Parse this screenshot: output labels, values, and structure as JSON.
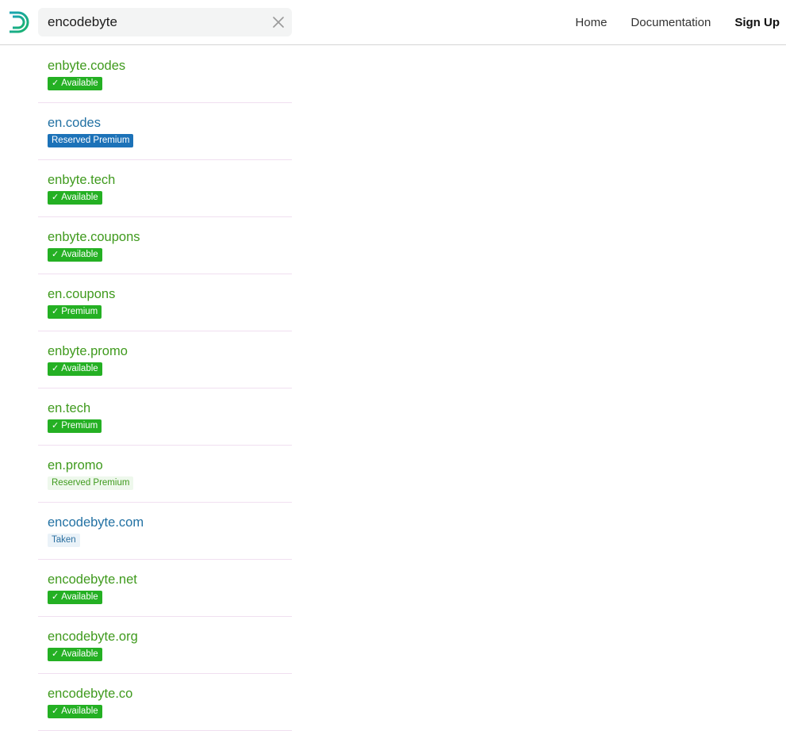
{
  "search": {
    "value": "encodebyte",
    "clear_icon": "close-icon"
  },
  "logo_icon": "logo-d-icon",
  "nav": {
    "home": "Home",
    "documentation": "Documentation",
    "signup": "Sign Up"
  },
  "colors": {
    "available_badge": "#24b023",
    "available_text": "#3f9a1d",
    "reserved_badge": "#1c72b8",
    "taken_text": "#2271a3"
  },
  "results": [
    {
      "domain": "enbyte.codes",
      "status": "available",
      "badge": "Available",
      "check": true
    },
    {
      "domain": "en.codes",
      "status": "reserved",
      "badge": "Reserved Premium",
      "check": false
    },
    {
      "domain": "enbyte.tech",
      "status": "available",
      "badge": "Available",
      "check": true
    },
    {
      "domain": "enbyte.coupons",
      "status": "available",
      "badge": "Available",
      "check": true
    },
    {
      "domain": "en.coupons",
      "status": "premium",
      "badge": "Premium",
      "check": true
    },
    {
      "domain": "enbyte.promo",
      "status": "available",
      "badge": "Available",
      "check": true
    },
    {
      "domain": "en.tech",
      "status": "premium",
      "badge": "Premium",
      "check": true
    },
    {
      "domain": "en.promo",
      "status": "reserved-light",
      "badge": "Reserved Premium",
      "check": false
    },
    {
      "domain": "encodebyte.com",
      "status": "taken",
      "badge": "Taken",
      "check": false
    },
    {
      "domain": "encodebyte.net",
      "status": "available",
      "badge": "Available",
      "check": true
    },
    {
      "domain": "encodebyte.org",
      "status": "available",
      "badge": "Available",
      "check": true
    },
    {
      "domain": "encodebyte.co",
      "status": "available",
      "badge": "Available",
      "check": true
    }
  ]
}
